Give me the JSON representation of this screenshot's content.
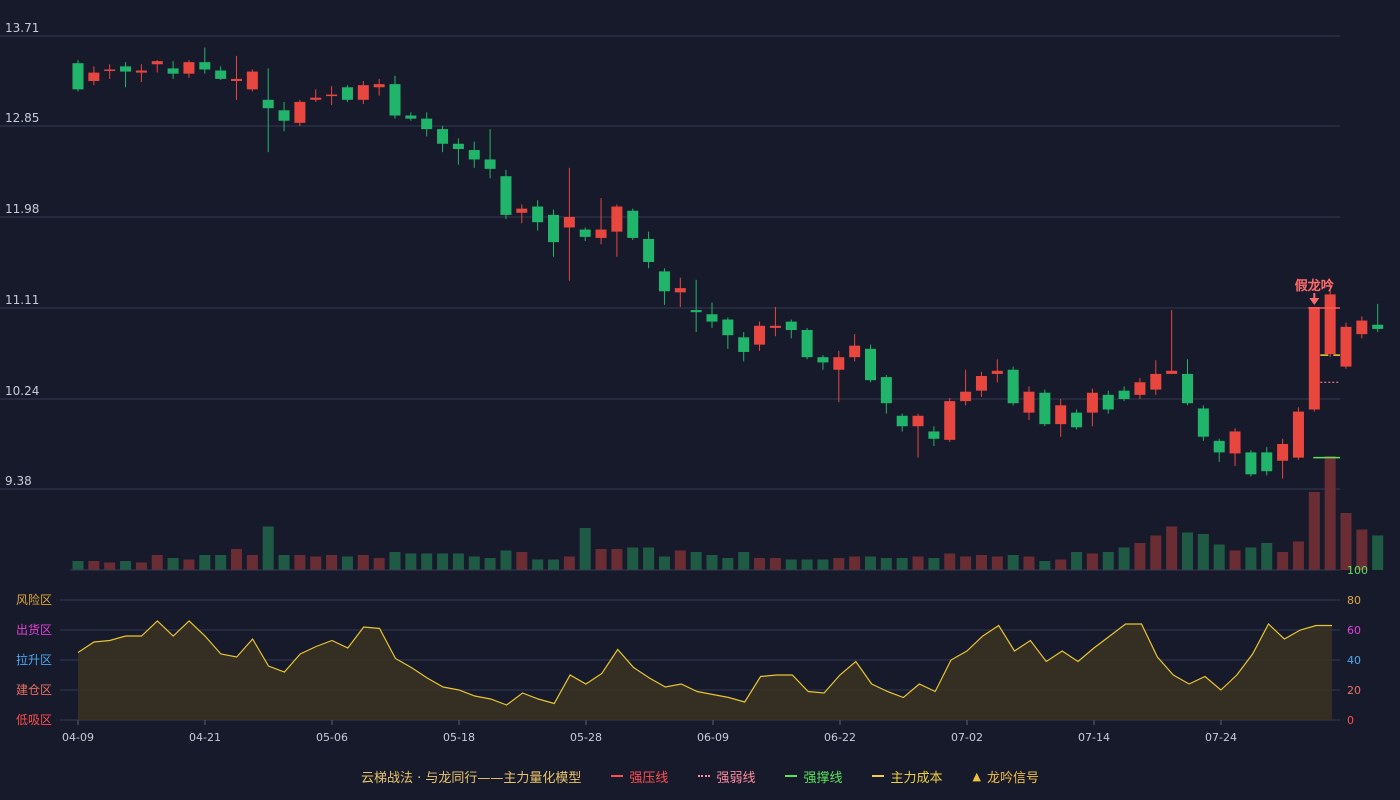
{
  "chart_data": {
    "type": "candlestick",
    "x_ticks": [
      "04-09",
      "04-21",
      "05-06",
      "05-18",
      "05-28",
      "06-09",
      "06-22",
      "07-02",
      "07-14",
      "07-24"
    ],
    "y_ticks": [
      "13.71",
      "12.85",
      "11.98",
      "11.11",
      "10.24",
      "9.38"
    ],
    "ylim": [
      9.38,
      13.71
    ],
    "candles": [
      [
        13.45,
        13.2,
        13.48,
        13.18
      ],
      [
        13.28,
        13.36,
        13.42,
        13.24
      ],
      [
        13.38,
        13.39,
        13.44,
        13.3
      ],
      [
        13.42,
        13.37,
        13.46,
        13.22
      ],
      [
        13.36,
        13.38,
        13.44,
        13.27
      ],
      [
        13.44,
        13.47,
        13.48,
        13.36
      ],
      [
        13.4,
        13.35,
        13.47,
        13.3
      ],
      [
        13.35,
        13.46,
        13.48,
        13.31
      ],
      [
        13.46,
        13.39,
        13.6,
        13.35
      ],
      [
        13.38,
        13.3,
        13.42,
        13.29
      ],
      [
        13.28,
        13.3,
        13.52,
        13.1
      ],
      [
        13.2,
        13.37,
        13.39,
        13.18
      ],
      [
        13.1,
        13.02,
        13.4,
        12.6
      ],
      [
        13.0,
        12.9,
        13.08,
        12.8
      ],
      [
        12.88,
        13.08,
        13.1,
        12.85
      ],
      [
        13.1,
        13.12,
        13.2,
        13.08
      ],
      [
        13.14,
        13.15,
        13.23,
        13.05
      ],
      [
        13.22,
        13.1,
        13.24,
        13.08
      ],
      [
        13.1,
        13.24,
        13.28,
        13.06
      ],
      [
        13.22,
        13.25,
        13.3,
        13.14
      ],
      [
        13.25,
        12.95,
        13.33,
        12.92
      ],
      [
        12.95,
        12.92,
        12.98,
        12.9
      ],
      [
        12.92,
        12.82,
        12.98,
        12.75
      ],
      [
        12.82,
        12.68,
        12.85,
        12.6
      ],
      [
        12.68,
        12.63,
        12.73,
        12.48
      ],
      [
        12.62,
        12.53,
        12.7,
        12.45
      ],
      [
        12.53,
        12.44,
        12.82,
        12.35
      ],
      [
        12.37,
        12.0,
        12.43,
        11.96
      ],
      [
        12.02,
        12.06,
        12.1,
        11.92
      ],
      [
        12.08,
        11.93,
        12.14,
        11.85
      ],
      [
        12.0,
        11.74,
        12.05,
        11.6
      ],
      [
        11.88,
        11.98,
        12.45,
        11.37
      ],
      [
        11.86,
        11.79,
        11.88,
        11.75
      ],
      [
        11.78,
        11.86,
        12.16,
        11.72
      ],
      [
        11.84,
        12.08,
        12.1,
        11.6
      ],
      [
        12.04,
        11.78,
        12.06,
        11.76
      ],
      [
        11.77,
        11.55,
        11.84,
        11.49
      ],
      [
        11.46,
        11.27,
        11.49,
        11.14
      ],
      [
        11.26,
        11.3,
        11.4,
        11.12
      ],
      [
        11.09,
        11.07,
        11.38,
        10.88
      ],
      [
        11.05,
        10.98,
        11.16,
        10.92
      ],
      [
        11.0,
        10.85,
        11.02,
        10.72
      ],
      [
        10.83,
        10.69,
        10.88,
        10.6
      ],
      [
        10.76,
        10.94,
        10.98,
        10.7
      ],
      [
        10.92,
        10.94,
        11.12,
        10.84
      ],
      [
        10.98,
        10.9,
        11.0,
        10.82
      ],
      [
        10.9,
        10.64,
        10.92,
        10.62
      ],
      [
        10.64,
        10.59,
        10.66,
        10.52
      ],
      [
        10.52,
        10.64,
        10.7,
        10.21
      ],
      [
        10.64,
        10.75,
        10.86,
        10.6
      ],
      [
        10.72,
        10.42,
        10.76,
        10.4
      ],
      [
        10.45,
        10.2,
        10.47,
        10.1
      ],
      [
        10.08,
        9.98,
        10.1,
        9.93
      ],
      [
        9.98,
        10.08,
        10.1,
        9.68
      ],
      [
        9.93,
        9.86,
        9.98,
        9.79
      ],
      [
        9.85,
        10.22,
        10.25,
        9.83
      ],
      [
        10.22,
        10.31,
        10.52,
        10.18
      ],
      [
        10.32,
        10.46,
        10.5,
        10.26
      ],
      [
        10.48,
        10.51,
        10.62,
        10.4
      ],
      [
        10.52,
        10.2,
        10.55,
        10.18
      ],
      [
        10.11,
        10.31,
        10.36,
        10.04
      ],
      [
        10.3,
        10.0,
        10.33,
        9.98
      ],
      [
        10.0,
        10.18,
        10.24,
        9.88
      ],
      [
        10.11,
        9.97,
        10.14,
        9.95
      ],
      [
        10.11,
        10.3,
        10.34,
        9.98
      ],
      [
        10.28,
        10.14,
        10.32,
        10.1
      ],
      [
        10.32,
        10.24,
        10.36,
        10.22
      ],
      [
        10.28,
        10.4,
        10.44,
        10.24
      ],
      [
        10.33,
        10.48,
        10.61,
        10.28
      ],
      [
        10.48,
        10.51,
        11.09,
        10.48
      ],
      [
        10.48,
        10.2,
        10.62,
        10.18
      ],
      [
        10.15,
        9.88,
        10.18,
        9.84
      ],
      [
        9.84,
        9.73,
        9.86,
        9.64
      ],
      [
        9.72,
        9.93,
        9.96,
        9.6
      ],
      [
        9.73,
        9.52,
        9.75,
        9.5
      ],
      [
        9.73,
        9.55,
        9.78,
        9.51
      ],
      [
        9.65,
        9.81,
        9.86,
        9.48
      ],
      [
        9.68,
        10.12,
        10.16,
        9.66
      ],
      [
        10.14,
        11.12,
        11.12,
        10.12
      ],
      [
        10.67,
        11.24,
        11.36,
        10.64
      ],
      [
        10.55,
        10.93,
        10.97,
        10.53
      ],
      [
        10.86,
        10.99,
        11.03,
        10.82
      ],
      [
        10.95,
        10.91,
        11.15,
        10.88
      ]
    ],
    "volume": [
      6,
      6,
      5,
      6,
      5,
      10,
      8,
      7,
      10,
      10,
      14,
      10,
      29,
      10,
      10,
      9,
      10,
      9,
      10,
      8,
      12,
      11,
      11,
      11,
      11,
      9,
      8,
      13,
      12,
      7,
      7,
      9,
      28,
      14,
      14,
      15,
      15,
      9,
      13,
      12,
      10,
      8,
      12,
      8,
      8,
      7,
      7,
      7,
      8,
      9,
      9,
      8,
      8,
      9,
      8,
      11,
      9,
      10,
      9,
      10,
      9,
      6,
      7,
      12,
      11,
      12,
      15,
      18,
      23,
      29,
      25,
      24,
      17,
      13,
      15,
      18,
      12,
      19,
      52,
      76,
      38,
      27,
      23
    ],
    "volume_max": 100,
    "indicator": [
      45,
      52,
      53,
      56,
      56,
      66,
      56,
      66,
      56,
      44,
      42,
      54,
      36,
      32,
      44,
      49,
      53,
      48,
      62,
      61,
      41,
      35,
      28,
      22,
      20,
      16,
      14,
      10,
      18,
      14,
      11,
      30,
      24,
      31,
      47,
      35,
      28,
      22,
      24,
      19,
      17,
      15,
      12,
      29,
      30,
      30,
      19,
      18,
      30,
      39,
      24,
      19,
      15,
      24,
      19,
      40,
      46,
      56,
      63,
      46,
      53,
      39,
      46,
      39,
      48,
      56,
      64,
      64,
      42,
      30,
      24,
      29,
      20,
      30,
      44,
      64,
      54,
      60,
      63,
      63
    ],
    "indicator_ticks": [
      "100",
      "80",
      "60",
      "40",
      "20",
      "0"
    ],
    "indicator_tick_colors": [
      "#59e35a",
      "#e0a83a",
      "#e040d8",
      "#4aa8f0",
      "#e87060",
      "#ff5050"
    ],
    "zones": [
      {
        "label": "风险区",
        "color": "#e0a83a"
      },
      {
        "label": "出货区",
        "color": "#e040d8"
      },
      {
        "label": "拉升区",
        "color": "#4aa8f0"
      },
      {
        "label": "建仓区",
        "color": "#e87060"
      },
      {
        "label": "低吸区",
        "color": "#ff4c4c"
      }
    ],
    "signal_text": "假龙吟",
    "signal_index": 78,
    "lines": {
      "strong_pressure": 11.11,
      "weak": 10.4,
      "main_cost": 10.66,
      "support": 9.68
    },
    "colors": {
      "up": "#e8473f",
      "down": "#21b56b",
      "indicator": "#e8c430",
      "pressure": "#ff5a5a",
      "weak": "#ff8aa0",
      "support": "#59e35a",
      "cost": "#f0d040"
    },
    "legend": [
      {
        "label": "云梯战法 · 与龙同行——主力量化模型",
        "symbol": "none",
        "color": "#e8c468"
      },
      {
        "label": "强压线",
        "symbol": "line",
        "color": "#ff4d4d"
      },
      {
        "label": "强弱线",
        "symbol": "dotted",
        "color": "#ff8aa0"
      },
      {
        "label": "强撑线",
        "symbol": "line",
        "color": "#59e35a"
      },
      {
        "label": "主力成本",
        "symbol": "dashed",
        "color": "#f0d040"
      },
      {
        "label": "龙吟信号",
        "symbol": "triangle",
        "color": "#f0c040"
      }
    ]
  }
}
